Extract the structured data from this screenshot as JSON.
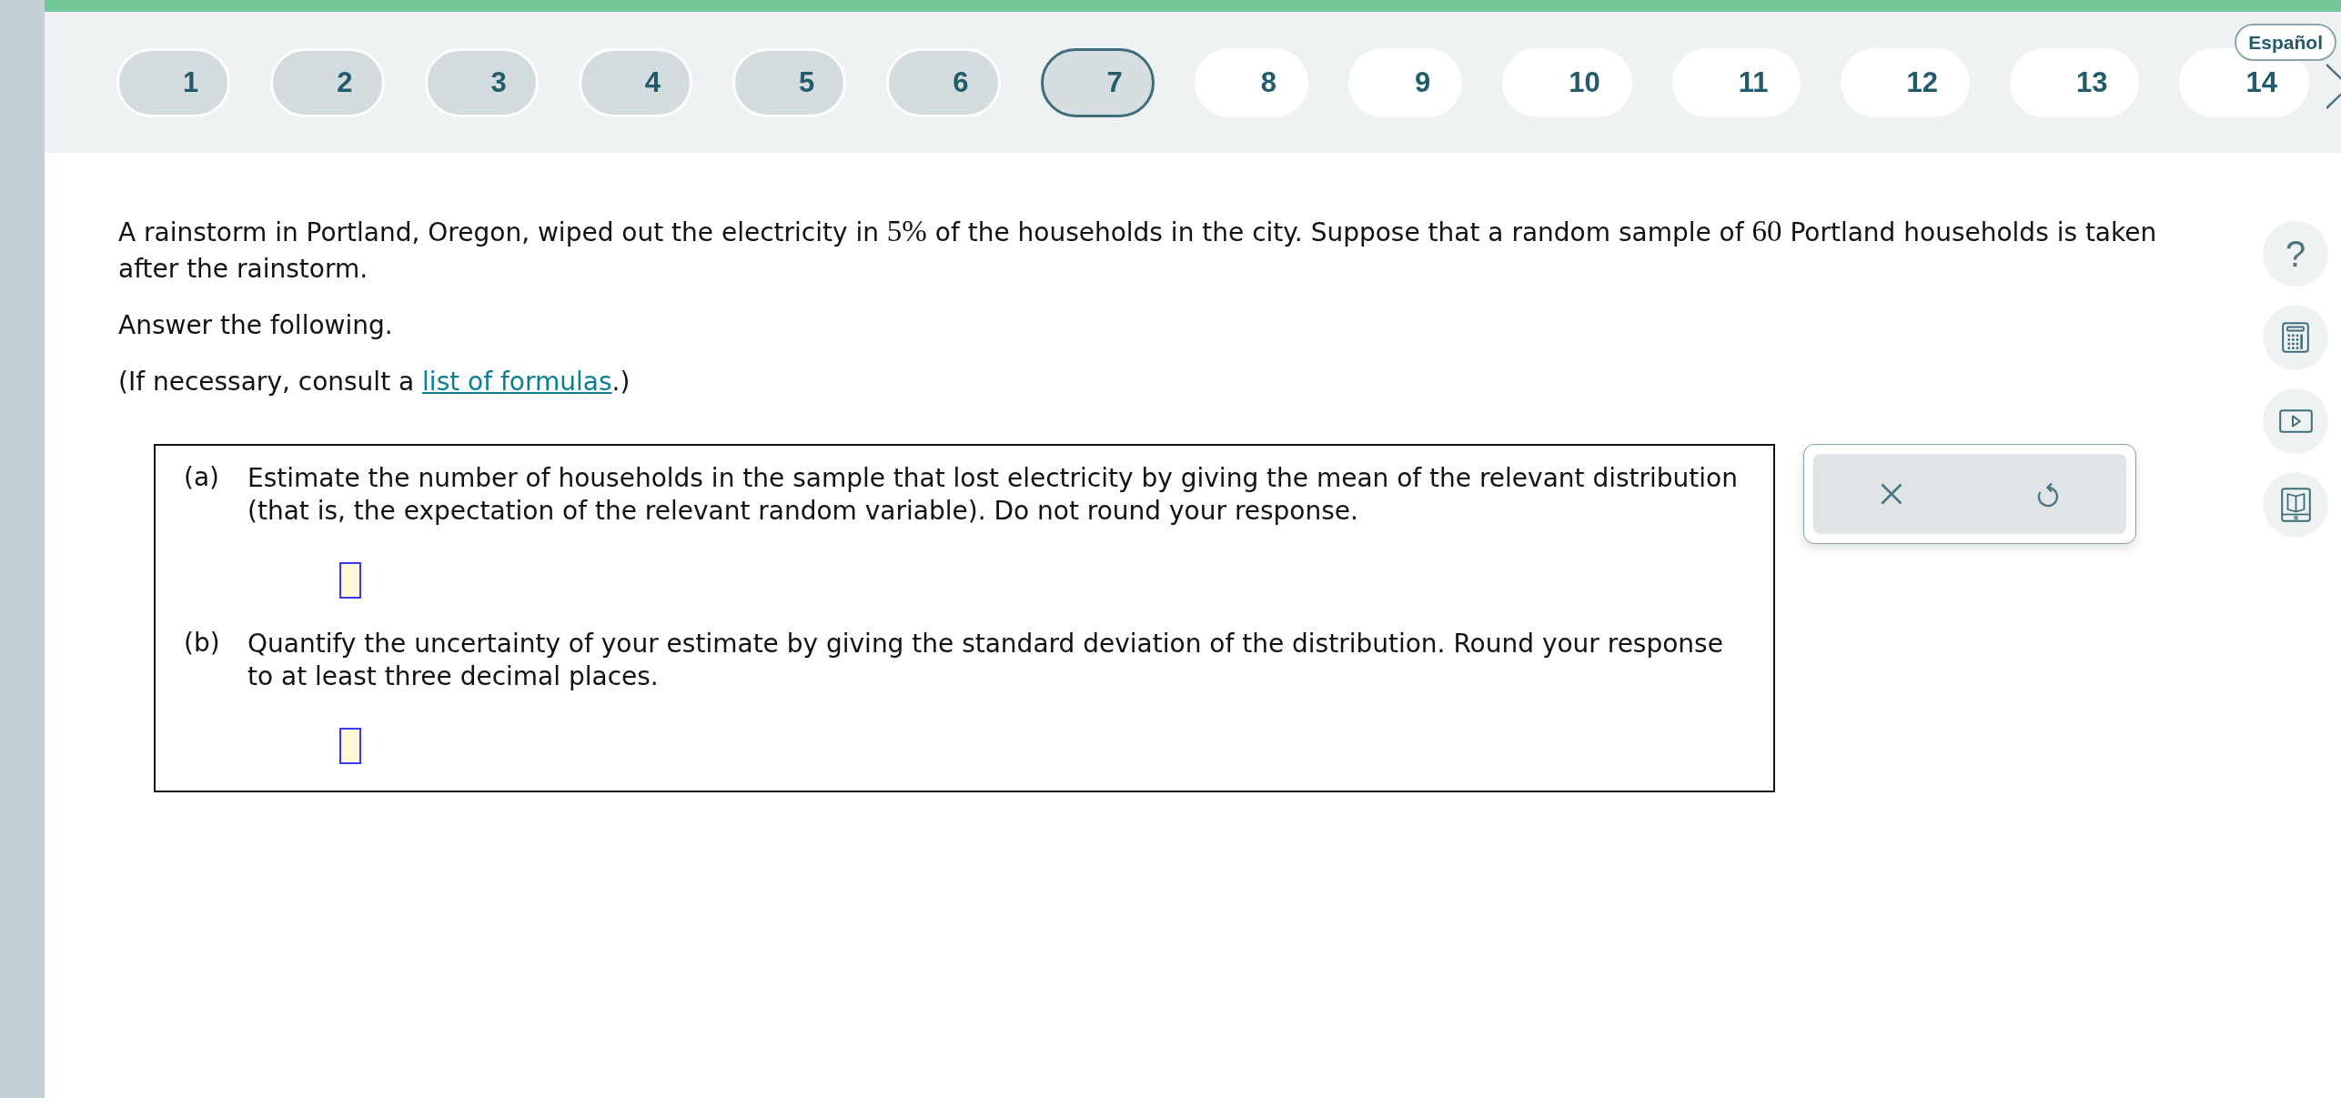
{
  "nav": {
    "questions": [
      {
        "label": "1",
        "answered": true,
        "selected": false
      },
      {
        "label": "2",
        "answered": true,
        "selected": false
      },
      {
        "label": "3",
        "answered": true,
        "selected": false
      },
      {
        "label": "4",
        "answered": true,
        "selected": false
      },
      {
        "label": "5",
        "answered": true,
        "selected": false
      },
      {
        "label": "6",
        "answered": true,
        "selected": false
      },
      {
        "label": "7",
        "answered": false,
        "selected": true
      },
      {
        "label": "8",
        "answered": false,
        "selected": false
      },
      {
        "label": "9",
        "answered": false,
        "selected": false
      },
      {
        "label": "10",
        "answered": false,
        "selected": false
      },
      {
        "label": "11",
        "answered": false,
        "selected": false
      },
      {
        "label": "12",
        "answered": false,
        "selected": false
      },
      {
        "label": "13",
        "answered": false,
        "selected": false
      },
      {
        "label": "14",
        "answered": false,
        "selected": false
      }
    ],
    "language": "Español"
  },
  "problem": {
    "intro": [
      {
        "kind": "text",
        "text": "A rainstorm in Portland, Oregon, wiped out the electricity in"
      },
      {
        "kind": "math",
        "text": "5%"
      },
      {
        "kind": "text",
        "text": "of the households in the city. Suppose that a random sample of"
      },
      {
        "kind": "math",
        "text": "60"
      },
      {
        "kind": "text",
        "text": "Portland households is taken after the rainstorm."
      }
    ],
    "instruction": "Answer the following.",
    "formulas_note": {
      "before": "(If necessary, consult a",
      "link": "list of formulas",
      "after": ".)"
    },
    "parts": [
      {
        "label": "(a)",
        "text": "Estimate the number of households in the sample that lost electricity by giving the mean of the relevant distribution (that is, the expectation of the relevant random variable). Do not round your response."
      },
      {
        "label": "(b)",
        "text": "Quantify the uncertainty of your estimate by giving the standard deviation of the distribution. Round your response to at least three decimal places."
      }
    ]
  },
  "tools": {
    "help": "?"
  }
}
